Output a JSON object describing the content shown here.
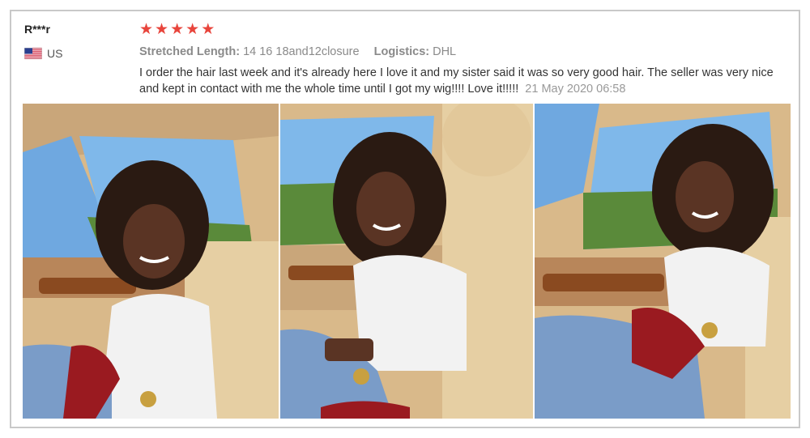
{
  "reviewer": {
    "name": "R***r",
    "country_code": "US",
    "flag_icon": "us-flag-icon"
  },
  "rating": {
    "stars": 5,
    "max": 5,
    "star_color": "#e8453c"
  },
  "attributes": [
    {
      "label": "Stretched Length:",
      "value": "14 16 18and12closure"
    },
    {
      "label": "Logistics:",
      "value": "DHL"
    }
  ],
  "review": {
    "text": "I order the hair last week and it's already here I love it and my sister said it was so very good hair. The seller was very nice and kept in contact with me the whole time until I got my wig!!!! Love it!!!!!",
    "date": "21 May 2020 06:58"
  },
  "photos": [
    {
      "name": "review-photo-1"
    },
    {
      "name": "review-photo-2"
    },
    {
      "name": "review-photo-3"
    }
  ]
}
